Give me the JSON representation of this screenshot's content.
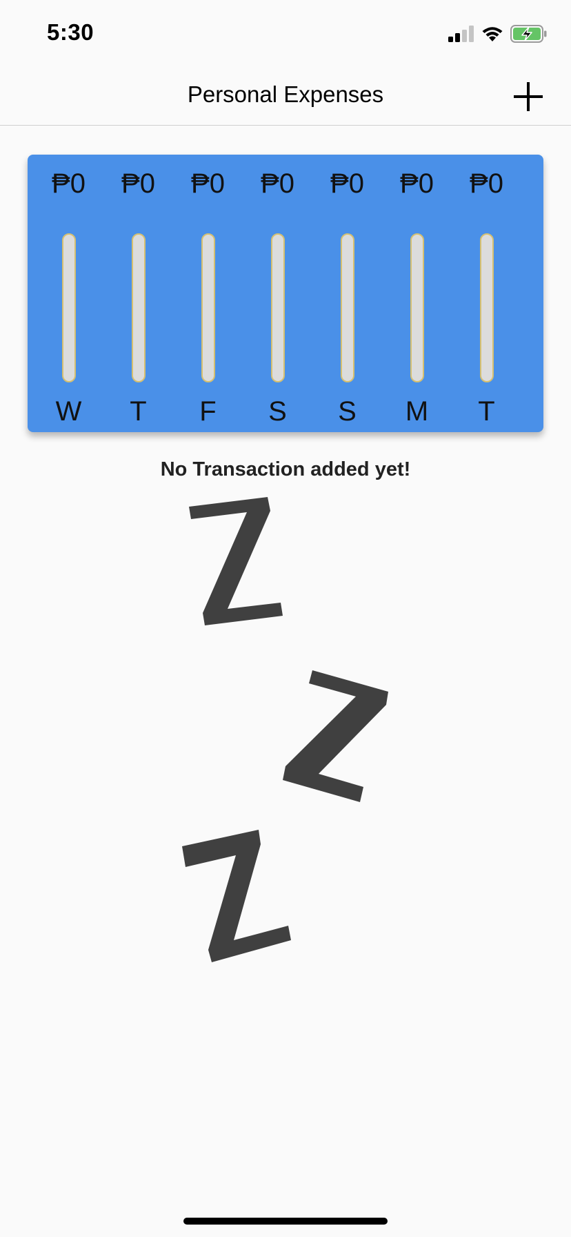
{
  "status": {
    "time": "5:30",
    "battery_color": "#65c466"
  },
  "nav": {
    "title": "Personal Expenses",
    "add_icon": "plus-icon"
  },
  "chart_data": {
    "type": "bar",
    "categories": [
      "W",
      "T",
      "F",
      "S",
      "S",
      "M",
      "T"
    ],
    "value_labels": [
      "₱0",
      "₱0",
      "₱0",
      "₱0",
      "₱0",
      "₱0",
      "₱0"
    ],
    "values": [
      0,
      0,
      0,
      0,
      0,
      0,
      0
    ],
    "background_color": "#4a90e8"
  },
  "empty_state": {
    "message": "No Transaction added yet!",
    "image_icon": "sleeping-zzz-icon"
  }
}
